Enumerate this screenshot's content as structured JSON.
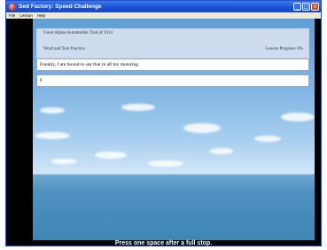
{
  "window": {
    "title": "Sed Factory: Speed Challenge",
    "controls": {
      "minimize": "_",
      "maximize": "□",
      "close": "×"
    }
  },
  "menubar": {
    "items": [
      {
        "label": "File"
      },
      {
        "label": "Lesson"
      },
      {
        "label": "Help"
      }
    ]
  },
  "lesson": {
    "title": "Great Alpine Automobile Trial of 1914",
    "subtitle": "Word and Text Practice",
    "progress_label": "Lesson Progress: 0%",
    "progress_value": 0
  },
  "typing": {
    "target_text": "Frankly, I am bound to say that in all my motoring",
    "input_value": "F"
  },
  "status": {
    "hint": "Press one space after a full stop."
  },
  "colors": {
    "titlebar": "#1d53d8",
    "menubar": "#ece9d8",
    "background": "#000000",
    "panel": "#d7e1f0"
  },
  "icons": {
    "app": "app-logo-icon"
  }
}
